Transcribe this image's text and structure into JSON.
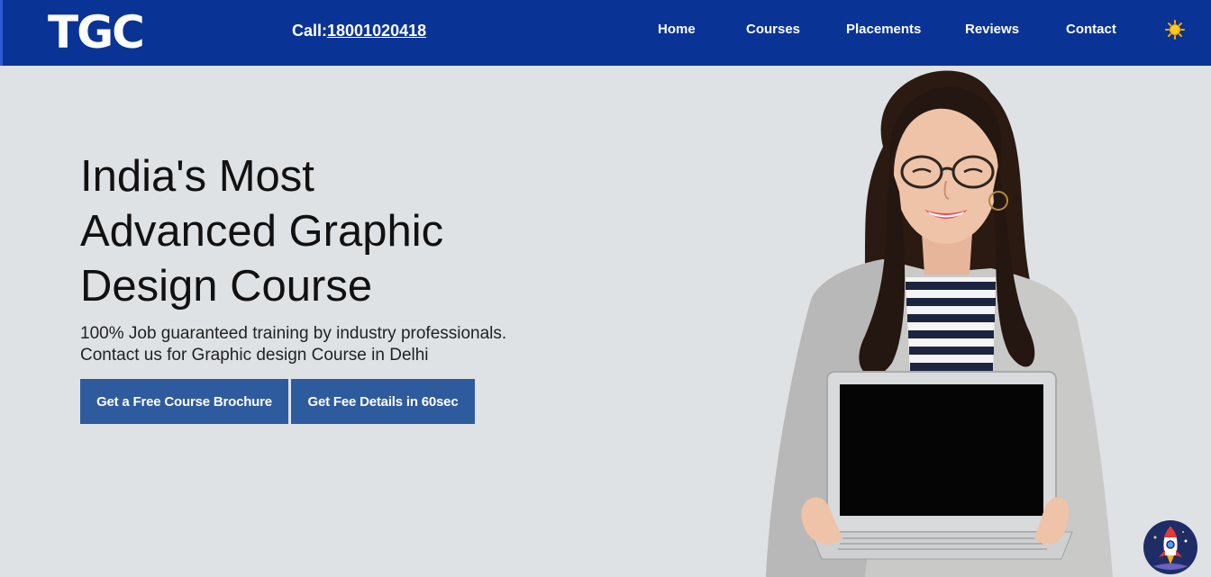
{
  "header": {
    "logo": "TGC",
    "call_prefix": "Call:",
    "phone": "18001020418",
    "nav": [
      "Home",
      "Courses",
      "Placements",
      "Reviews",
      "Contact"
    ],
    "theme_icon": "sun-icon"
  },
  "hero": {
    "title_lines": [
      "India's Most",
      "Advanced Graphic",
      "Design Course"
    ],
    "subtitle_lines": [
      "100% Job guaranteed training by industry professionals.",
      "Contact us for Graphic design Course in Delhi"
    ],
    "primary_button": "Get a Free Course Brochure",
    "secondary_button": "Get Fee Details in 60sec"
  },
  "floating_button_icon": "rocket-icon",
  "colors": {
    "header_bg": "#0a3396",
    "button_bg": "#2e5b9e",
    "page_bg": "#dfe2e5"
  }
}
